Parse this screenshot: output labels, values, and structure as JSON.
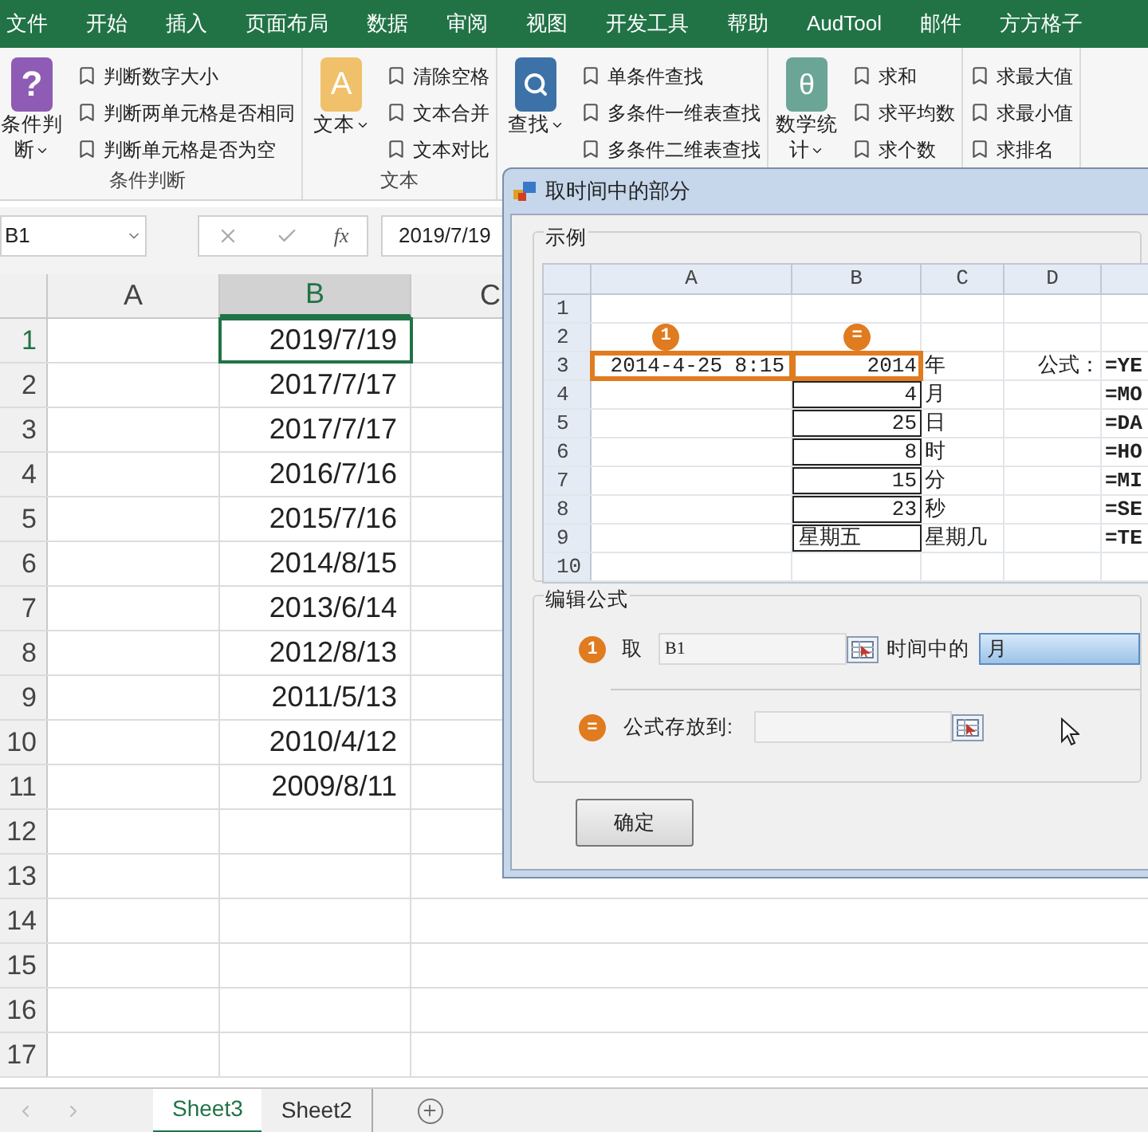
{
  "ribbon_tabs": [
    "文件",
    "开始",
    "插入",
    "页面布局",
    "数据",
    "审阅",
    "视图",
    "开发工具",
    "帮助",
    "AudTool",
    "邮件",
    "方方格子"
  ],
  "ribbon_groups": [
    {
      "label": "条件判断",
      "big": {
        "kind": "question",
        "glyph": "?",
        "lines": [
          "条件判",
          "断"
        ]
      },
      "items": [
        "判断数字大小",
        "判断两单元格是否相同",
        "判断单元格是否为空"
      ]
    },
    {
      "label": "文本",
      "big": {
        "kind": "letter",
        "glyph": "A",
        "lines": [
          "文本"
        ]
      },
      "items": [
        "清除空格",
        "文本合并",
        "文本对比"
      ]
    },
    {
      "big": {
        "kind": "search",
        "lines": [
          "查找"
        ]
      },
      "items": [
        "单条件查找",
        "多条件一维表查找",
        "多条件二维表查找"
      ]
    },
    {
      "big": {
        "kind": "math",
        "glyph": "θ",
        "lines": [
          "数学统",
          "计"
        ]
      },
      "items": [
        "求和",
        "求平均数",
        "求个数"
      ]
    },
    {
      "items": [
        "求最大值",
        "求最小值",
        "求排名"
      ]
    }
  ],
  "formula_bar": {
    "name_box": "B1",
    "function_label": "fx",
    "value": "2019/7/19"
  },
  "sheet": {
    "columns": [
      {
        "label": "A",
        "selected": false
      },
      {
        "label": "B",
        "selected": true
      },
      {
        "label": "C",
        "selected": false
      }
    ],
    "rows": [
      {
        "number": "1",
        "value": "2019/7/19",
        "selected": true
      },
      {
        "number": "2",
        "value": "2017/7/17",
        "selected": false
      },
      {
        "number": "3",
        "value": "2017/7/17",
        "selected": false
      },
      {
        "number": "4",
        "value": "2016/7/16",
        "selected": false
      },
      {
        "number": "5",
        "value": "2015/7/16",
        "selected": false
      },
      {
        "number": "6",
        "value": "2014/8/15",
        "selected": false
      },
      {
        "number": "7",
        "value": "2013/6/14",
        "selected": false
      },
      {
        "number": "8",
        "value": "2012/8/13",
        "selected": false
      },
      {
        "number": "9",
        "value": "2011/5/13",
        "selected": false
      },
      {
        "number": "10",
        "value": "2010/4/12",
        "selected": false
      },
      {
        "number": "11",
        "value": "2009/8/11",
        "selected": false
      },
      {
        "number": "12",
        "selected": false
      },
      {
        "number": "13",
        "selected": false
      },
      {
        "number": "14",
        "selected": false
      },
      {
        "number": "15",
        "selected": false
      },
      {
        "number": "16",
        "selected": false
      },
      {
        "number": "17",
        "selected": false
      }
    ]
  },
  "sheet_tabs": [
    {
      "label": "Sheet3",
      "selected": true
    },
    {
      "label": "Sheet2",
      "selected": false
    }
  ],
  "dialog": {
    "title": "取时间中的部分",
    "example": {
      "label": "示例",
      "columns": [
        "A",
        "B",
        "C",
        "D"
      ],
      "markers": [
        "1",
        "="
      ],
      "rows": [
        {
          "number": "1",
          "highlighted": false,
          "boxed": false
        },
        {
          "number": "2",
          "highlighted": false,
          "boxed": false,
          "has_markers": true
        },
        {
          "number": "3",
          "a": "2014-4-25 8:15",
          "b": "2014",
          "c": "年",
          "d": "公式：",
          "e": "=YE",
          "highlighted": true,
          "boxed": true
        },
        {
          "number": "4",
          "b": "4",
          "c": "月",
          "e": "=MO",
          "highlighted": false,
          "boxed": true
        },
        {
          "number": "5",
          "b": "25",
          "c": "日",
          "e": "=DA",
          "highlighted": false,
          "boxed": true
        },
        {
          "number": "6",
          "b": "8",
          "c": "时",
          "e": "=HO",
          "highlighted": false,
          "boxed": true
        },
        {
          "number": "7",
          "b": "15",
          "c": "分",
          "e": "=MI",
          "highlighted": false,
          "boxed": true
        },
        {
          "number": "8",
          "b": "23",
          "c": "秒",
          "e": "=SE",
          "highlighted": false,
          "boxed": true
        },
        {
          "number": "9",
          "b": "星期五",
          "c": "星期几",
          "e": "=TE",
          "highlighted": false,
          "boxed": true
        },
        {
          "number": "10",
          "highlighted": false,
          "boxed": false
        }
      ]
    },
    "edit": {
      "label": "编辑公式",
      "step1": {
        "badge": "1",
        "label": "取",
        "value": "B1",
        "middle_label": "时间中的",
        "choice": "月"
      },
      "step2": {
        "badge": "=",
        "label": "公式存放到:"
      }
    },
    "ok_button": "确定"
  }
}
